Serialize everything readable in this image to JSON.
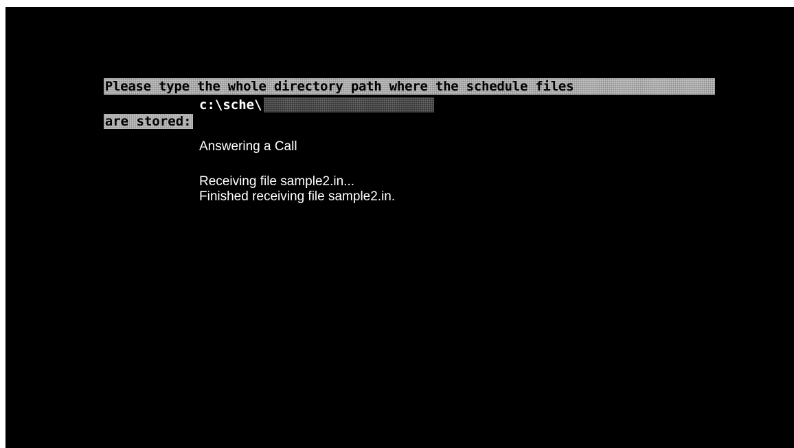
{
  "prompt": {
    "line1": "Please type the whole directory path where the schedule files",
    "line2": "are stored:"
  },
  "path_input": {
    "value": "c:\\sche\\"
  },
  "status": {
    "title": "Answering a Call",
    "lines": [
      "Receiving file sample2.in...",
      "Finished receiving file sample2.in."
    ]
  },
  "colors": {
    "background": "#000000",
    "text": "#ffffff",
    "highlight": "#bdbdbd"
  }
}
